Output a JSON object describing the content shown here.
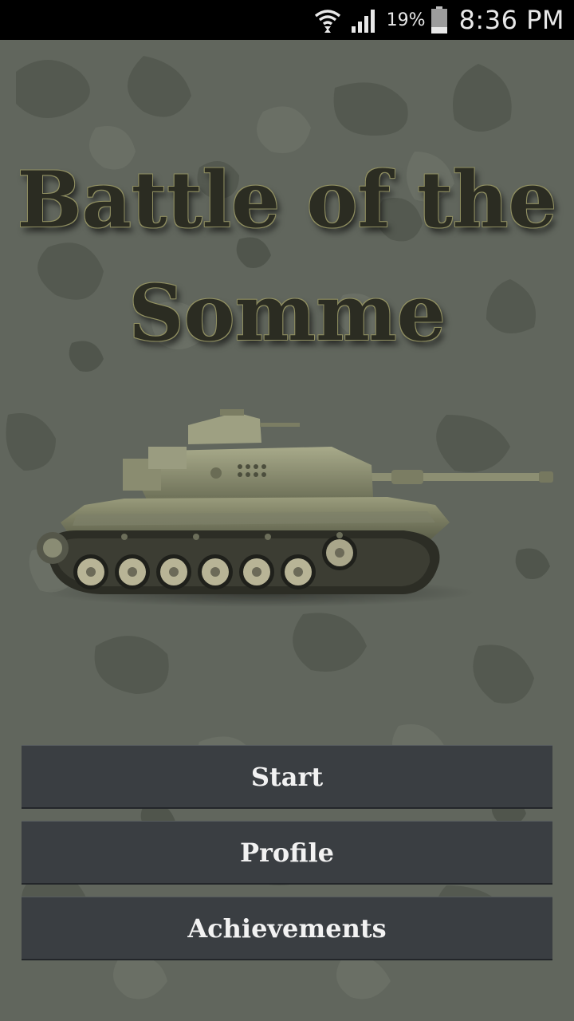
{
  "status_bar": {
    "battery_percent": "19%",
    "time": "8:36 PM",
    "icons": [
      "wifi-icon",
      "signal-icon",
      "battery-icon"
    ]
  },
  "title": {
    "line1": "Battle of the",
    "line2": "Somme"
  },
  "hero_image": "tank-image",
  "menu": {
    "start_label": "Start",
    "profile_label": "Profile",
    "achievements_label": "Achievements"
  },
  "colors": {
    "background_camo": "#5f645b",
    "button_bg": "#3a3e42",
    "button_text": "#f2f2f2",
    "title_text": "#2b2c22",
    "title_outline": "#8f8e60"
  }
}
